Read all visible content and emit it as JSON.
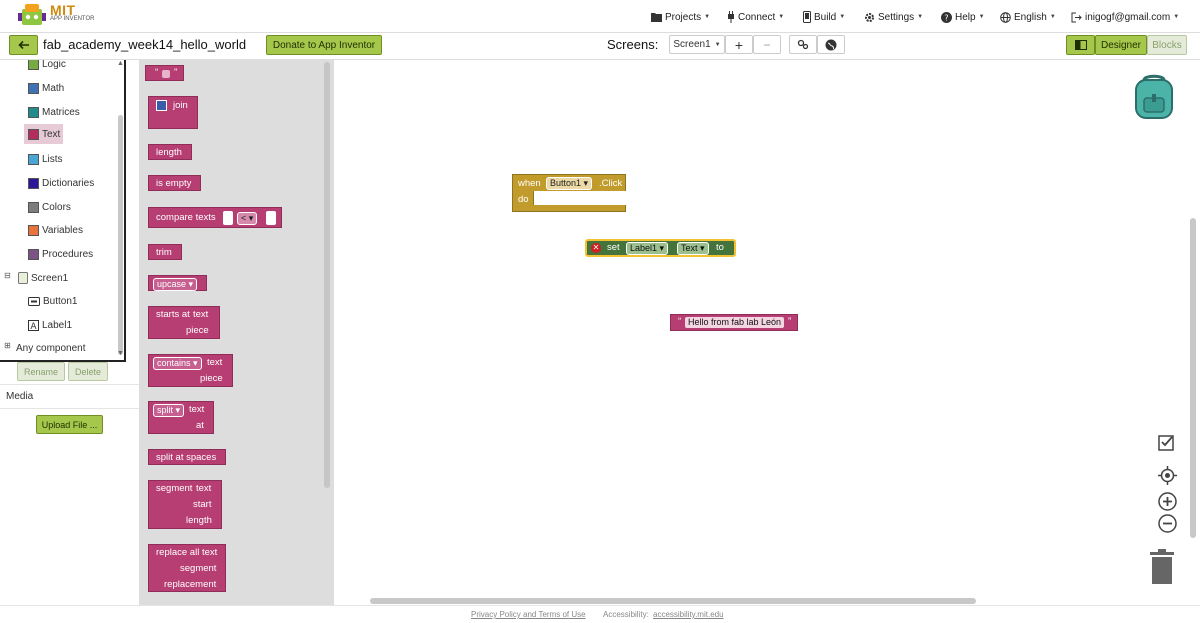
{
  "app": {
    "logo_title": "MIT",
    "logo_subtitle": "APP INVENTOR"
  },
  "menu": {
    "projects": "Projects",
    "connect": "Connect",
    "build": "Build",
    "settings": "Settings",
    "help": "Help",
    "language": "English",
    "account": "inigogf@gmail.com"
  },
  "project": {
    "name": "fab_academy_week14_hello_world",
    "donate_label": "Donate to App Inventor",
    "screens_label": "Screens:",
    "current_screen": "Screen1",
    "add_screen": "+",
    "remove_screen": "−",
    "designer_label": "Designer",
    "blocks_label": "Blocks"
  },
  "tree": {
    "builtins": [
      {
        "label": "Logic",
        "color": "#77ab41"
      },
      {
        "label": "Math",
        "color": "#3f71b5"
      },
      {
        "label": "Matrices",
        "color": "#228b8b"
      },
      {
        "label": "Text",
        "color": "#b32d5e"
      },
      {
        "label": "Lists",
        "color": "#49a6d4"
      },
      {
        "label": "Dictionaries",
        "color": "#2d1799"
      },
      {
        "label": "Colors",
        "color": "#7d7d7d"
      },
      {
        "label": "Variables",
        "color": "#e8733d"
      },
      {
        "label": "Procedures",
        "color": "#7c5385"
      }
    ],
    "screen": "Screen1",
    "components": [
      "Button1",
      "Label1"
    ],
    "any_component": "Any component",
    "rename_label": "Rename",
    "delete_label": "Delete"
  },
  "media": {
    "title": "Media",
    "upload_label": "Upload File ..."
  },
  "flyout": {
    "blocks": {
      "string_q1": "“",
      "string_q2": "”",
      "join": "join",
      "length": "length",
      "is_empty": "is empty",
      "compare": "compare texts",
      "compare_op": "<",
      "trim": "trim",
      "upcase": "upcase",
      "starts_at": "starts at",
      "contains": "contains",
      "split": "split",
      "split_spaces": "split at spaces",
      "segment": "segment",
      "replace_all": "replace all text",
      "text": "text",
      "piece": "piece",
      "at": "at",
      "start": "start",
      "length_param": "length",
      "segment_param": "segment",
      "replacement": "replacement"
    }
  },
  "workspace": {
    "event_when": "when",
    "event_component": "Button1",
    "event_name": ".Click",
    "event_do": "do",
    "set_label": "set",
    "set_component": "Label1",
    "set_property": "Text",
    "set_to": "to",
    "string_value": "Hello from fab lab León",
    "string_q1": "“",
    "string_q2": "”"
  },
  "footer": {
    "privacy": "Privacy Policy and Terms of Use",
    "accessibility_label": "Accessibility:",
    "accessibility_link": "accessibility.mit.edu"
  },
  "colors": {
    "text_block": "#b63e72",
    "control_block": "#c19c2d",
    "component_block": "#44743b",
    "accent_green": "#a5c84c"
  }
}
